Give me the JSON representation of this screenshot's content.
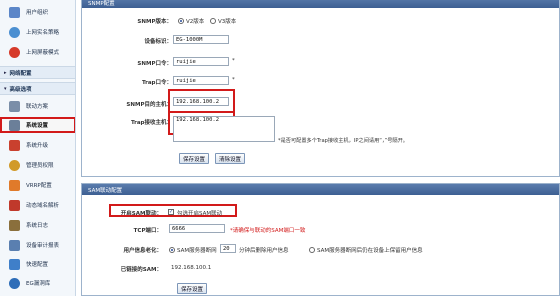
{
  "sidebar": {
    "items": [
      {
        "label": "用户组织",
        "color": "#5b86c8"
      },
      {
        "label": "上网实名策略",
        "color": "#4b8fd1"
      },
      {
        "label": "上网屏蔽模式",
        "color": "#d63a2a"
      }
    ],
    "section_network": "网络配置",
    "section_advanced": "高级选项",
    "advanced_items": [
      {
        "label": "联动方案",
        "color": "#7a8ea8"
      },
      {
        "label": "系统设置",
        "color": "#6b7f99"
      },
      {
        "label": "系统升级",
        "color": "#c9402e"
      },
      {
        "label": "管理员权限",
        "color": "#d19a2a"
      },
      {
        "label": "VRRP配置",
        "color": "#e07a2a"
      },
      {
        "label": "动态域名解析",
        "color": "#c0392b"
      },
      {
        "label": "系统日志",
        "color": "#8a6f3c"
      },
      {
        "label": "设备审计报表",
        "color": "#5a7fb0"
      },
      {
        "label": "快速配置",
        "color": "#3f7fc9"
      },
      {
        "label": "EG漏洞库",
        "color": "#2e6db8"
      }
    ]
  },
  "snmp": {
    "header": "SNMP配置",
    "version_label": "SNMP版本：",
    "version_options": [
      "V2版本",
      "V3版本"
    ],
    "device_label": "设备标识：",
    "device_value": "EG-1000M",
    "read_label": "SNMP口令：",
    "read_value": "ruijie",
    "trap_label": "Trap口令：",
    "trap_value": "ruijie",
    "host_label": "SNMP目的主机：",
    "host_value": "192.168.100.2",
    "trap_host_label": "Trap接收主机：",
    "trap_host_value": "192.168.100.2",
    "trap_hint": "*是否可配置多个Trap接收主机，IP之间请用“，”号隔开。",
    "save_label": "保存设置",
    "clear_label": "清除设置"
  },
  "sam": {
    "header": "SAM联动配置",
    "enable_label": "开启SAM联动：",
    "enable_text": "勾选开启SAM联动",
    "tcp_label": "TCP端口：",
    "tcp_value": "6666",
    "tcp_hint": "*请确保与联动的SAM端口一致",
    "user_label": "用户信息老化：",
    "user_opt1": "SAM服务器断网",
    "user_opt1_value": "20",
    "user_opt1_suffix": "分钟后删除用户信息",
    "user_opt2": "SAM服务器断网后仍在设备上保留用户信息",
    "connected_label": "已链接的SAM：",
    "connected_value": "192.168.100.1",
    "save_label": "保存设置"
  }
}
